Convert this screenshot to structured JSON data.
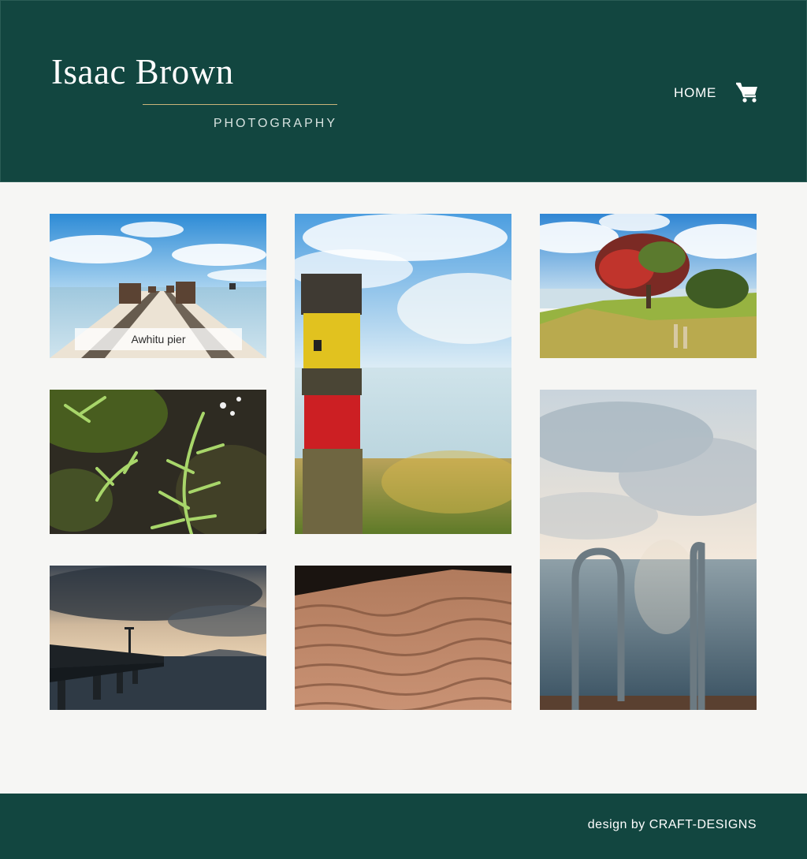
{
  "header": {
    "brand_name": "Isaac Brown",
    "brand_subtitle": "PHOTOGRAPHY",
    "nav": {
      "home_label": "HOME"
    },
    "cart_icon": "cart-icon"
  },
  "gallery": {
    "tiles": [
      {
        "id": "awhitu-pier",
        "caption": "Awhitu pier"
      },
      {
        "id": "marker-post"
      },
      {
        "id": "pohutukawa-tree"
      },
      {
        "id": "fern-plant"
      },
      {
        "id": "pool-ladder-sea"
      },
      {
        "id": "wharf-sunset"
      },
      {
        "id": "sand-ripples"
      }
    ]
  },
  "footer": {
    "credit": "design by CRAFT-DESIGNS"
  },
  "colors": {
    "header_bg": "#124640",
    "footer_bg": "#124640",
    "page_bg": "#f6f6f4",
    "accent_rule": "#c8b37a"
  }
}
